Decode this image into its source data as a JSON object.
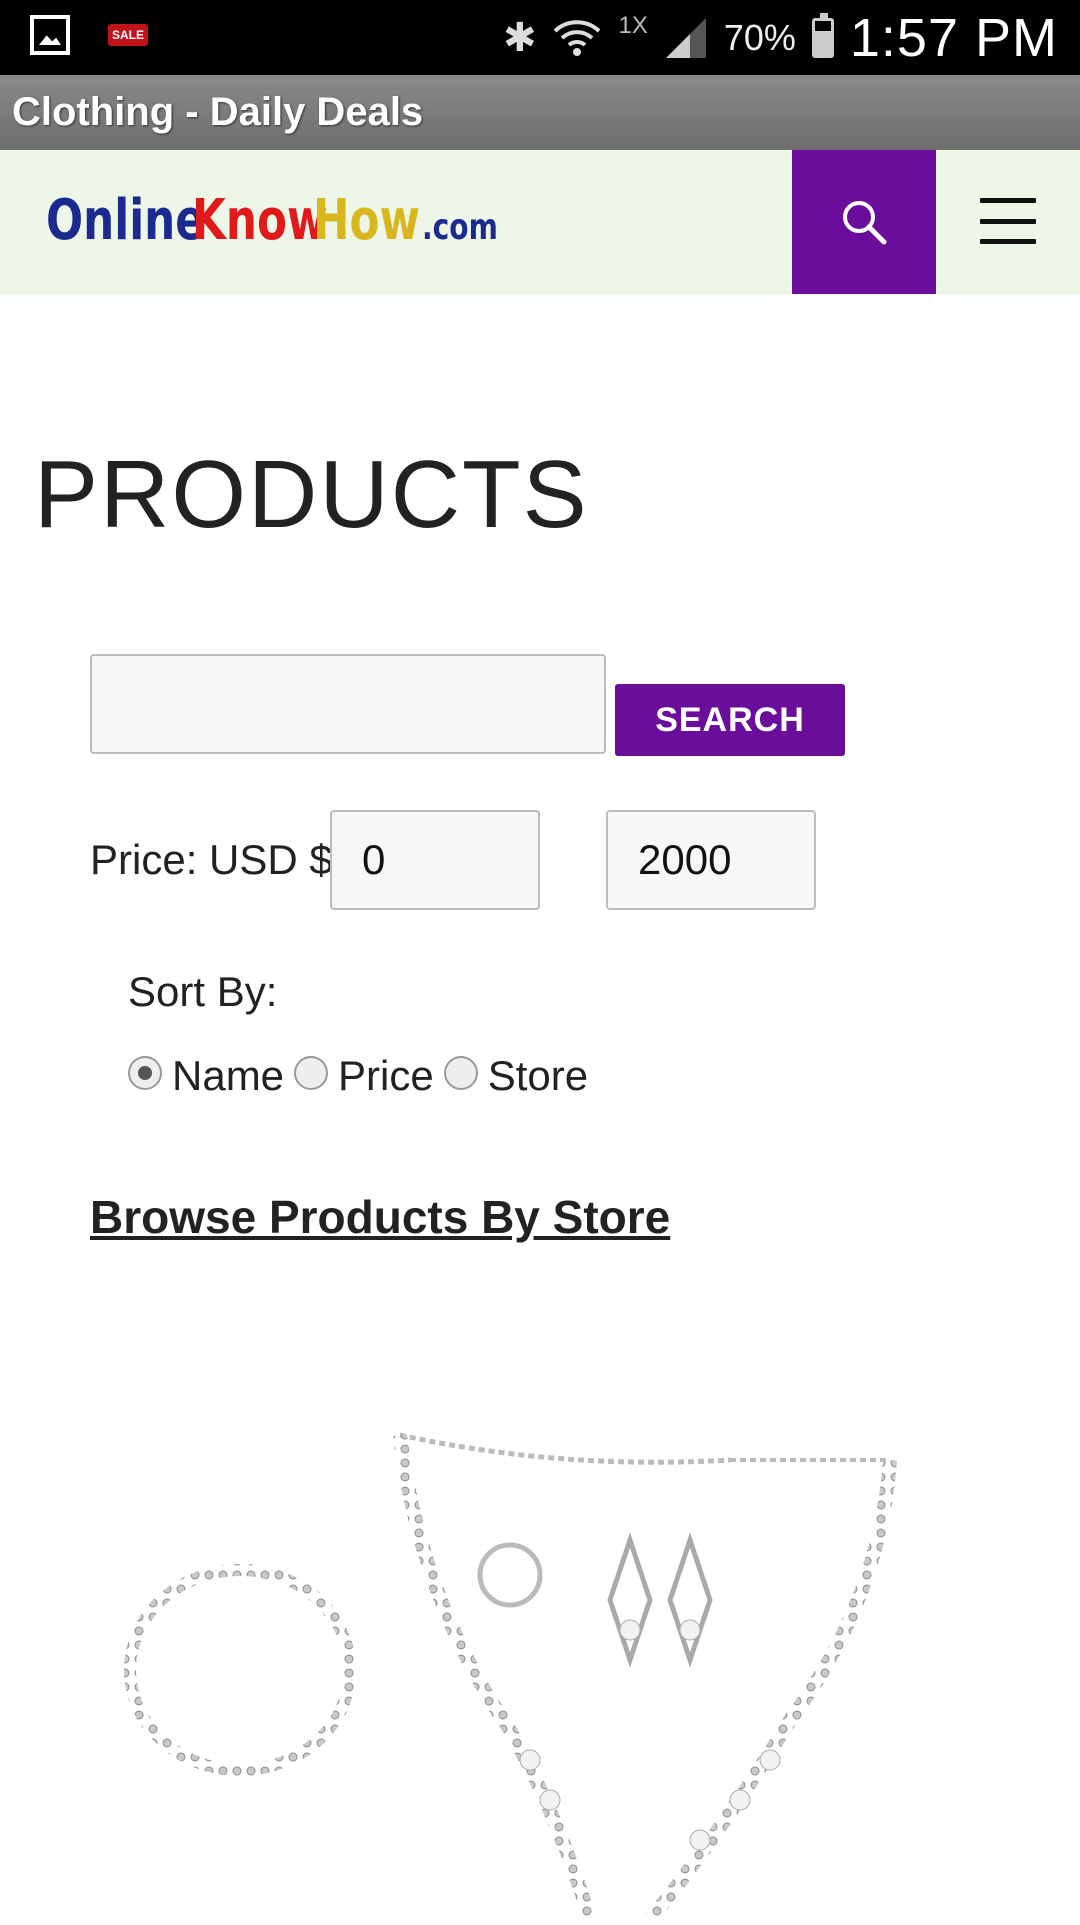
{
  "status_bar": {
    "notification_icons": [
      "gallery-icon",
      "sale-icon"
    ],
    "sale_badge": "SALE",
    "network_type": "1X",
    "battery_percent": "70%",
    "time": "1:57 PM"
  },
  "app_bar": {
    "title": "Clothing - Daily Deals"
  },
  "site_header": {
    "logo": {
      "part1": "Online",
      "part2": "Know",
      "part3": "How",
      "part4": ".com"
    },
    "search_icon": "search-icon",
    "menu_icon": "hamburger-menu-icon",
    "accent_color": "#6a0d9a"
  },
  "main": {
    "page_title": "PRODUCTS",
    "search": {
      "value": "",
      "button_label": "SEARCH"
    },
    "price": {
      "label": "Price: USD $",
      "min": "0",
      "max": "2000"
    },
    "sort": {
      "label": "Sort By:",
      "options": [
        {
          "label": "Name",
          "checked": true
        },
        {
          "label": "Price",
          "checked": false
        },
        {
          "label": "Store",
          "checked": false
        }
      ]
    },
    "browse_link": "Browse Products By Store",
    "product_image_alt": "jewelry-set-image"
  }
}
